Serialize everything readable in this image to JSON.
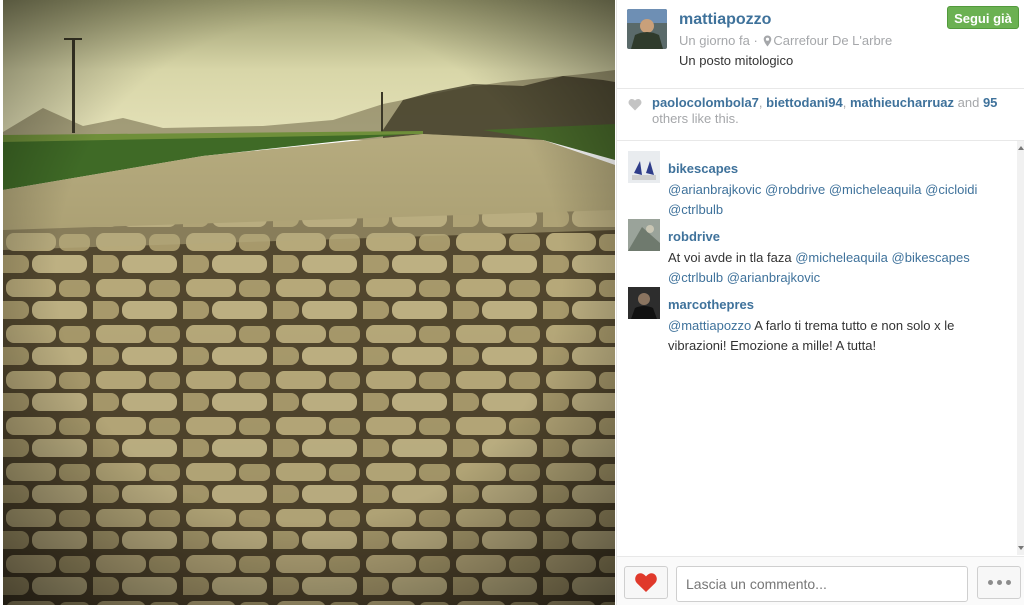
{
  "post": {
    "username": "mattiapozzo",
    "time": "Un giorno fa",
    "separator": "·",
    "location": "Carrefour De L'arbre",
    "caption": "Un posto mitologico",
    "follow_label": "Segui già",
    "follow_color": "#6bb152"
  },
  "likes": {
    "user1": "paolocolombola7",
    "user2": "biettodani94",
    "user3": "mathieucharruaz",
    "and": "and",
    "count": "95",
    "tail": "others like this.",
    "sep": ", "
  },
  "comments": [
    {
      "user": "bikescapes",
      "parts": [
        "@arianbrajkovic",
        " ",
        "@robdrive",
        " ",
        "@micheleaquila",
        " ",
        "@cicloidi",
        " ",
        "@ctrlbulb"
      ]
    },
    {
      "user": "robdrive",
      "text": "At voi avde in tla faza ",
      "mentions": [
        "@micheleaquila",
        "@bikescapes",
        "@ctrlbulb",
        "@arianbrajkovic"
      ]
    },
    {
      "user": "marcothepres",
      "mention": "@mattiapozzo",
      "text": " A farlo ti trema tutto e non solo x le vibrazioni! Emozione a mille! A tutta!"
    }
  ],
  "footer": {
    "comment_placeholder": "Lascia un commento...",
    "like_icon": "heart-icon",
    "more_icon": "ellipsis-icon"
  },
  "colors": {
    "link": "#3f729b",
    "muted": "#a5a7aa",
    "heart": "#e0392b"
  }
}
